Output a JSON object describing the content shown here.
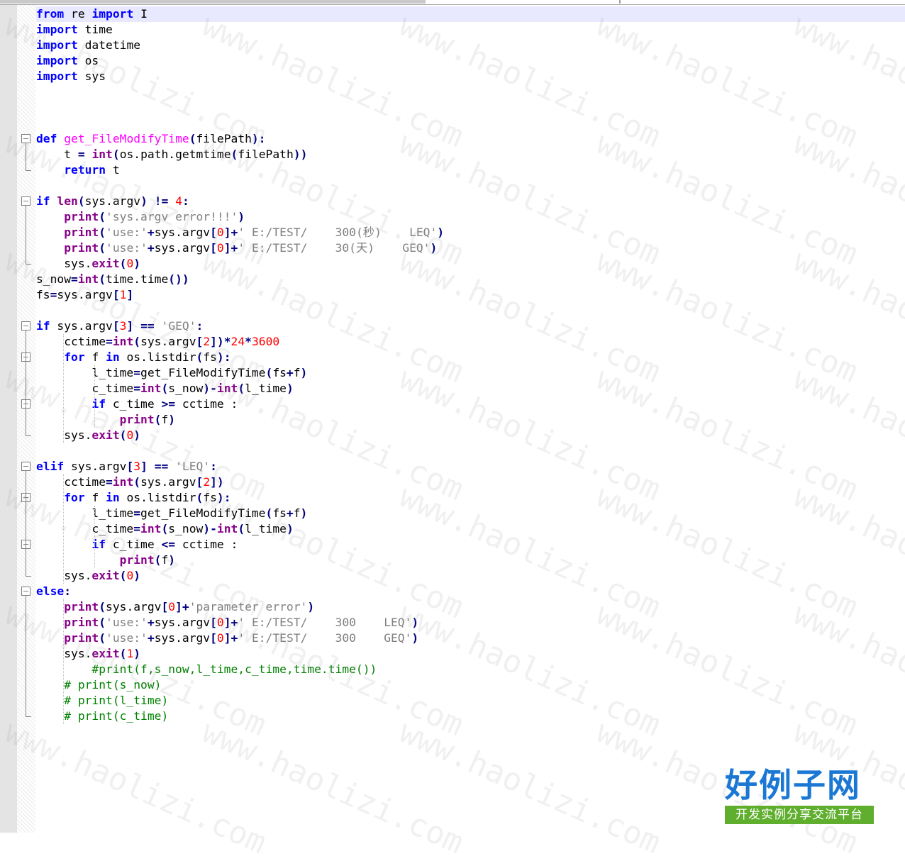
{
  "editor": {
    "lines": [
      [
        [
          "kw",
          "from"
        ],
        [
          "pl",
          " re "
        ],
        [
          "kw",
          "import"
        ],
        [
          "pl",
          " I"
        ]
      ],
      [
        [
          "kw",
          "import"
        ],
        [
          "pl",
          " time"
        ]
      ],
      [
        [
          "kw",
          "import"
        ],
        [
          "pl",
          " datetime"
        ]
      ],
      [
        [
          "kw",
          "import"
        ],
        [
          "pl",
          " os"
        ]
      ],
      [
        [
          "kw",
          "import"
        ],
        [
          "pl",
          " sys"
        ]
      ],
      [],
      [],
      [],
      [
        [
          "kw",
          "def"
        ],
        [
          "pl",
          " "
        ],
        [
          "fn",
          "get_FileModifyTime"
        ],
        [
          "op",
          "("
        ],
        [
          "pl",
          "filePath"
        ],
        [
          "op",
          "):"
        ]
      ],
      [
        [
          "pl",
          "    t "
        ],
        [
          "op",
          "="
        ],
        [
          "pl",
          " "
        ],
        [
          "bi",
          "int"
        ],
        [
          "op",
          "("
        ],
        [
          "pl",
          "os.path.getmtime"
        ],
        [
          "op",
          "("
        ],
        [
          "pl",
          "filePath"
        ],
        [
          "op",
          "))"
        ]
      ],
      [
        [
          "pl",
          "    "
        ],
        [
          "kw",
          "return"
        ],
        [
          "pl",
          " t"
        ]
      ],
      [],
      [
        [
          "kw",
          "if"
        ],
        [
          "pl",
          " "
        ],
        [
          "bi",
          "len"
        ],
        [
          "op",
          "("
        ],
        [
          "pl",
          "sys.argv"
        ],
        [
          "op",
          ")"
        ],
        [
          "pl",
          " "
        ],
        [
          "op",
          "!="
        ],
        [
          "pl",
          " "
        ],
        [
          "num",
          "4"
        ],
        [
          "op",
          ":"
        ]
      ],
      [
        [
          "pl",
          "    "
        ],
        [
          "bi",
          "print"
        ],
        [
          "op",
          "("
        ],
        [
          "str",
          "'sys.argv error!!!'"
        ],
        [
          "op",
          ")"
        ]
      ],
      [
        [
          "pl",
          "    "
        ],
        [
          "bi",
          "print"
        ],
        [
          "op",
          "("
        ],
        [
          "str",
          "'use:'"
        ],
        [
          "op",
          "+"
        ],
        [
          "pl",
          "sys.argv"
        ],
        [
          "op",
          "["
        ],
        [
          "num",
          "0"
        ],
        [
          "op",
          "]+"
        ],
        [
          "str",
          "' E:/TEST/    300(秒)    LEQ'"
        ],
        [
          "op",
          ")"
        ]
      ],
      [
        [
          "pl",
          "    "
        ],
        [
          "bi",
          "print"
        ],
        [
          "op",
          "("
        ],
        [
          "str",
          "'use:'"
        ],
        [
          "op",
          "+"
        ],
        [
          "pl",
          "sys.argv"
        ],
        [
          "op",
          "["
        ],
        [
          "num",
          "0"
        ],
        [
          "op",
          "]+"
        ],
        [
          "str",
          "' E:/TEST/    30(天)    GEQ'"
        ],
        [
          "op",
          ")"
        ]
      ],
      [
        [
          "pl",
          "    sys."
        ],
        [
          "bi",
          "exit"
        ],
        [
          "op",
          "("
        ],
        [
          "num",
          "0"
        ],
        [
          "op",
          ")"
        ]
      ],
      [
        [
          "pl",
          "s_now"
        ],
        [
          "op",
          "="
        ],
        [
          "bi",
          "int"
        ],
        [
          "op",
          "("
        ],
        [
          "pl",
          "time.time"
        ],
        [
          "op",
          "())"
        ]
      ],
      [
        [
          "pl",
          "fs"
        ],
        [
          "op",
          "="
        ],
        [
          "pl",
          "sys.argv"
        ],
        [
          "op",
          "["
        ],
        [
          "num",
          "1"
        ],
        [
          "op",
          "]"
        ]
      ],
      [],
      [
        [
          "kw",
          "if"
        ],
        [
          "pl",
          " sys.argv"
        ],
        [
          "op",
          "["
        ],
        [
          "num",
          "3"
        ],
        [
          "op",
          "]"
        ],
        [
          "pl",
          " "
        ],
        [
          "op",
          "=="
        ],
        [
          "pl",
          " "
        ],
        [
          "str",
          "'GEQ'"
        ],
        [
          "op",
          ":"
        ]
      ],
      [
        [
          "pl",
          "    cctime"
        ],
        [
          "op",
          "="
        ],
        [
          "bi",
          "int"
        ],
        [
          "op",
          "("
        ],
        [
          "pl",
          "sys.argv"
        ],
        [
          "op",
          "["
        ],
        [
          "num",
          "2"
        ],
        [
          "op",
          "])*"
        ],
        [
          "num",
          "24"
        ],
        [
          "op",
          "*"
        ],
        [
          "num",
          "3600"
        ]
      ],
      [
        [
          "pl",
          "    "
        ],
        [
          "kw",
          "for"
        ],
        [
          "pl",
          " f "
        ],
        [
          "kw",
          "in"
        ],
        [
          "pl",
          " os.listdir"
        ],
        [
          "op",
          "("
        ],
        [
          "pl",
          "fs"
        ],
        [
          "op",
          "):"
        ]
      ],
      [
        [
          "pl",
          "        l_time"
        ],
        [
          "op",
          "="
        ],
        [
          "pl",
          "get_FileModifyTime"
        ],
        [
          "op",
          "("
        ],
        [
          "pl",
          "fs"
        ],
        [
          "op",
          "+"
        ],
        [
          "pl",
          "f"
        ],
        [
          "op",
          ")"
        ]
      ],
      [
        [
          "pl",
          "        c_time"
        ],
        [
          "op",
          "="
        ],
        [
          "bi",
          "int"
        ],
        [
          "op",
          "("
        ],
        [
          "pl",
          "s_now"
        ],
        [
          "op",
          ")-"
        ],
        [
          "bi",
          "int"
        ],
        [
          "op",
          "("
        ],
        [
          "pl",
          "l_time"
        ],
        [
          "op",
          ")"
        ]
      ],
      [
        [
          "pl",
          "        "
        ],
        [
          "kw",
          "if"
        ],
        [
          "pl",
          " c_time "
        ],
        [
          "op",
          ">="
        ],
        [
          "pl",
          " cctime :"
        ]
      ],
      [
        [
          "pl",
          "            "
        ],
        [
          "bi",
          "print"
        ],
        [
          "op",
          "("
        ],
        [
          "pl",
          "f"
        ],
        [
          "op",
          ")"
        ]
      ],
      [
        [
          "pl",
          "    sys."
        ],
        [
          "bi",
          "exit"
        ],
        [
          "op",
          "("
        ],
        [
          "num",
          "0"
        ],
        [
          "op",
          ")"
        ]
      ],
      [],
      [
        [
          "kw",
          "elif"
        ],
        [
          "pl",
          " sys.argv"
        ],
        [
          "op",
          "["
        ],
        [
          "num",
          "3"
        ],
        [
          "op",
          "]"
        ],
        [
          "pl",
          " "
        ],
        [
          "op",
          "=="
        ],
        [
          "pl",
          " "
        ],
        [
          "str",
          "'LEQ'"
        ],
        [
          "op",
          ":"
        ]
      ],
      [
        [
          "pl",
          "    cctime"
        ],
        [
          "op",
          "="
        ],
        [
          "bi",
          "int"
        ],
        [
          "op",
          "("
        ],
        [
          "pl",
          "sys.argv"
        ],
        [
          "op",
          "["
        ],
        [
          "num",
          "2"
        ],
        [
          "op",
          "])"
        ]
      ],
      [
        [
          "pl",
          "    "
        ],
        [
          "kw",
          "for"
        ],
        [
          "pl",
          " f "
        ],
        [
          "kw",
          "in"
        ],
        [
          "pl",
          " os.listdir"
        ],
        [
          "op",
          "("
        ],
        [
          "pl",
          "fs"
        ],
        [
          "op",
          "):"
        ]
      ],
      [
        [
          "pl",
          "        l_time"
        ],
        [
          "op",
          "="
        ],
        [
          "pl",
          "get_FileModifyTime"
        ],
        [
          "op",
          "("
        ],
        [
          "pl",
          "fs"
        ],
        [
          "op",
          "+"
        ],
        [
          "pl",
          "f"
        ],
        [
          "op",
          ")"
        ]
      ],
      [
        [
          "pl",
          "        c_time"
        ],
        [
          "op",
          "="
        ],
        [
          "bi",
          "int"
        ],
        [
          "op",
          "("
        ],
        [
          "pl",
          "s_now"
        ],
        [
          "op",
          ")-"
        ],
        [
          "bi",
          "int"
        ],
        [
          "op",
          "("
        ],
        [
          "pl",
          "l_time"
        ],
        [
          "op",
          ")"
        ]
      ],
      [
        [
          "pl",
          "        "
        ],
        [
          "kw",
          "if"
        ],
        [
          "pl",
          " c_time "
        ],
        [
          "op",
          "<="
        ],
        [
          "pl",
          " cctime :"
        ]
      ],
      [
        [
          "pl",
          "            "
        ],
        [
          "bi",
          "print"
        ],
        [
          "op",
          "("
        ],
        [
          "pl",
          "f"
        ],
        [
          "op",
          ")"
        ]
      ],
      [
        [
          "pl",
          "    sys."
        ],
        [
          "bi",
          "exit"
        ],
        [
          "op",
          "("
        ],
        [
          "num",
          "0"
        ],
        [
          "op",
          ")"
        ]
      ],
      [
        [
          "kw",
          "else"
        ],
        [
          "op",
          ":"
        ]
      ],
      [
        [
          "pl",
          "    "
        ],
        [
          "bi",
          "print"
        ],
        [
          "op",
          "("
        ],
        [
          "pl",
          "sys.argv"
        ],
        [
          "op",
          "["
        ],
        [
          "num",
          "0"
        ],
        [
          "op",
          "]+"
        ],
        [
          "str",
          "'parameter error'"
        ],
        [
          "op",
          ")"
        ]
      ],
      [
        [
          "pl",
          "    "
        ],
        [
          "bi",
          "print"
        ],
        [
          "op",
          "("
        ],
        [
          "str",
          "'use:'"
        ],
        [
          "op",
          "+"
        ],
        [
          "pl",
          "sys.argv"
        ],
        [
          "op",
          "["
        ],
        [
          "num",
          "0"
        ],
        [
          "op",
          "]+"
        ],
        [
          "str",
          "' E:/TEST/    300    LEQ'"
        ],
        [
          "op",
          ")"
        ]
      ],
      [
        [
          "pl",
          "    "
        ],
        [
          "bi",
          "print"
        ],
        [
          "op",
          "("
        ],
        [
          "str",
          "'use:'"
        ],
        [
          "op",
          "+"
        ],
        [
          "pl",
          "sys.argv"
        ],
        [
          "op",
          "["
        ],
        [
          "num",
          "0"
        ],
        [
          "op",
          "]+"
        ],
        [
          "str",
          "' E:/TEST/    300    GEQ'"
        ],
        [
          "op",
          ")"
        ]
      ],
      [
        [
          "pl",
          "    sys."
        ],
        [
          "bi",
          "exit"
        ],
        [
          "op",
          "("
        ],
        [
          "num",
          "1"
        ],
        [
          "op",
          ")"
        ]
      ],
      [
        [
          "cm",
          "        #print(f,s_now,l_time,c_time,time.time())"
        ]
      ],
      [
        [
          "cm",
          "    # print(s_now)"
        ]
      ],
      [
        [
          "cm",
          "    # print(l_time)"
        ]
      ],
      [
        [
          "cm",
          "    # print(c_time)"
        ]
      ]
    ]
  },
  "watermark": {
    "text": "www.haolizi.com"
  },
  "logo": {
    "title": "好例子网",
    "subtitle": "开发实例分享交流平台"
  }
}
